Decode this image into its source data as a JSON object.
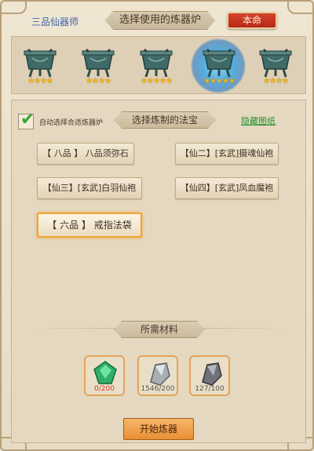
{
  "header": {
    "rank_label": "三品仙器师",
    "title": "选择使用的炼器炉",
    "fate_button": "本命"
  },
  "furnaces": [
    {
      "icon": "bronze-cauldron-icon",
      "stars": "★★★★",
      "selected": false
    },
    {
      "icon": "bronze-cauldron-icon",
      "stars": "★★★★",
      "selected": false
    },
    {
      "icon": "bronze-cauldron-icon",
      "stars": "★★★★★",
      "selected": false
    },
    {
      "icon": "bronze-cauldron-icon",
      "stars": "★★★★★",
      "selected": true
    },
    {
      "icon": "bronze-cauldron-icon",
      "stars": "★★★★",
      "selected": false
    }
  ],
  "recipe_panel": {
    "auto_select_label": "自动选择合适炼器炉",
    "auto_select_checked": true,
    "title": "选择炼制的法宝",
    "hide_link": "隐藏图纸",
    "recipes": [
      {
        "label": "【 八品 】 八品须弥石",
        "selected": false
      },
      {
        "label": "【仙二】[玄武]摄魂仙袍",
        "selected": false
      },
      {
        "label": "【仙三】[玄武]白羽仙袍",
        "selected": false
      },
      {
        "label": "【仙四】[玄武]凤血魔袍",
        "selected": false
      },
      {
        "label": "【 六品 】 戒指法袋",
        "selected": true
      }
    ]
  },
  "materials": {
    "title": "所需材料",
    "items": [
      {
        "icon": "green-jade-icon",
        "count": "0/200",
        "insufficient": true,
        "color": "#2fae6a"
      },
      {
        "icon": "silver-ore-icon",
        "count": "1546/200",
        "insufficient": false,
        "color": "#a9aeb5"
      },
      {
        "icon": "dark-ore-icon",
        "count": "127/100",
        "insufficient": false,
        "color": "#6f7279"
      }
    ]
  },
  "start_button": "开始炼器"
}
